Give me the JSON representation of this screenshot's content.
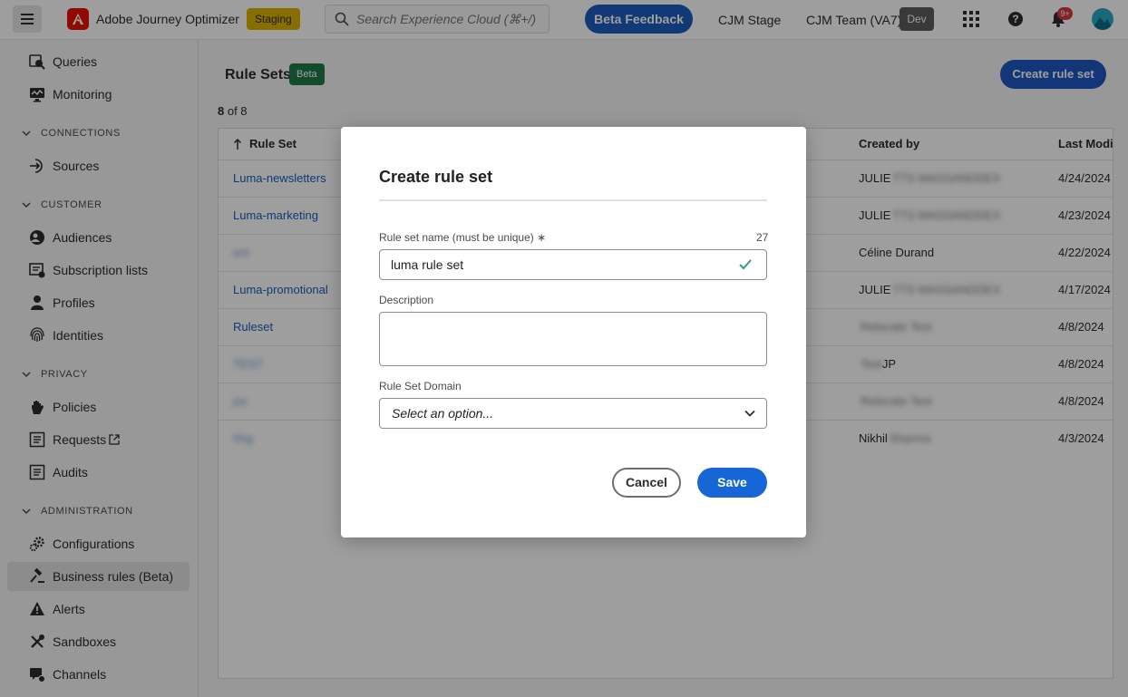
{
  "topbar": {
    "app_title": "Adobe Journey Optimizer",
    "env_badge": "Staging",
    "search_placeholder": "Search Experience Cloud (⌘+/)",
    "beta_feedback": "Beta Feedback",
    "org_stage": "CJM Stage",
    "sandbox": "CJM Team (VA7)",
    "sandbox_badge": "Dev",
    "notification_count": "9+"
  },
  "sidebar": {
    "queries": "Queries",
    "monitoring": "Monitoring",
    "connections_head": "CONNECTIONS",
    "sources": "Sources",
    "customer_head": "CUSTOMER",
    "audiences": "Audiences",
    "subscription_lists": "Subscription lists",
    "profiles": "Profiles",
    "identities": "Identities",
    "privacy_head": "PRIVACY",
    "policies": "Policies",
    "requests": "Requests",
    "audits": "Audits",
    "administration_head": "ADMINISTRATION",
    "configurations": "Configurations",
    "business_rules": "Business rules (Beta)",
    "alerts": "Alerts",
    "sandboxes": "Sandboxes",
    "channels": "Channels"
  },
  "main": {
    "title": "Rule Sets",
    "beta_badge": "Beta",
    "create_button": "Create rule set",
    "count_shown": "8",
    "count_of": " of 8",
    "columns": {
      "rule_set": "Rule Set",
      "created_by": "Created by",
      "last_modified": "Last Modi"
    },
    "rows": [
      {
        "name": "Luma-newsletters",
        "created_by": "JULIE",
        "created_by_blur": "TTS MASSANDDEX",
        "date": "4/24/2024",
        "blur_name": false
      },
      {
        "name": "Luma-marketing",
        "created_by": "JULIE",
        "created_by_blur": "TTS MASSANDDEX",
        "date": "4/23/2024",
        "blur_name": false
      },
      {
        "name": "ext",
        "created_by": "Céline Durand",
        "created_by_blur": "",
        "date": "4/22/2024",
        "blur_name": true
      },
      {
        "name": "Luma-promotional",
        "created_by": "JULIE",
        "created_by_blur": "TTS MASSANDDEX",
        "date": "4/17/2024",
        "blur_name": false
      },
      {
        "name": "Ruleset",
        "created_by": "",
        "created_by_blur": "Relocate Test",
        "date": "4/8/2024",
        "blur_name": false
      },
      {
        "name": "TEST",
        "created_by": "JP",
        "created_by_blur": "Test",
        "date": "4/8/2024",
        "blur_name": true
      },
      {
        "name": "jss",
        "created_by": "",
        "created_by_blur": "Relocate Test",
        "date": "4/8/2024",
        "blur_name": true
      },
      {
        "name": "hhg",
        "created_by": "Nikhil",
        "created_by_blur": "Sharma",
        "date": "4/3/2024",
        "blur_name": true
      }
    ]
  },
  "modal": {
    "title": "Create rule set",
    "name_label": "Rule set name (must be unique)",
    "required_mark": "∗",
    "char_count": "27",
    "name_value": "luma rule set",
    "description_label": "Description",
    "domain_label": "Rule Set Domain",
    "domain_placeholder": "Select an option...",
    "cancel": "Cancel",
    "save": "Save"
  },
  "colors": {
    "accent": "#1a5dbd",
    "staging": "#d8b300",
    "beta": "#1e7b4a",
    "adobe_red": "#eb1000",
    "valid_green": "#2d9d78"
  }
}
